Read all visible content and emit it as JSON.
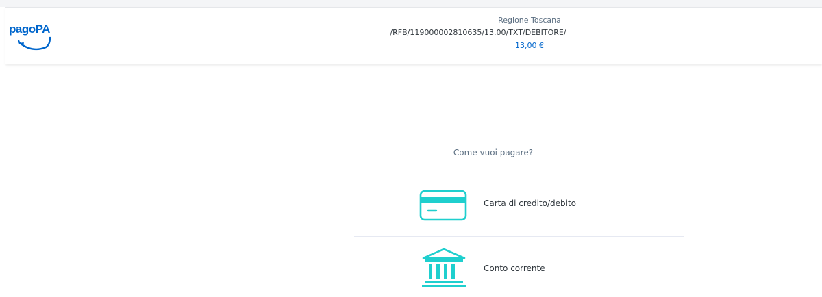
{
  "header": {
    "logo_text": "pagoPA",
    "creditor_name": "Regione Toscana",
    "payment_reason": "/RFB/119000002810635/13.00/TXT/DEBITORE/",
    "amount": "13,00 €"
  },
  "main": {
    "question": "Come vuoi pagare?",
    "options": [
      {
        "label": "Carta di credito/debito",
        "icon": "credit-card-icon"
      },
      {
        "label": "Conto corrente",
        "icon": "bank-icon"
      }
    ]
  },
  "colors": {
    "brand_blue": "#0066cc",
    "icon_teal": "#1fcfce",
    "text_dark": "#30373d",
    "text_muted": "#5c6f82"
  }
}
